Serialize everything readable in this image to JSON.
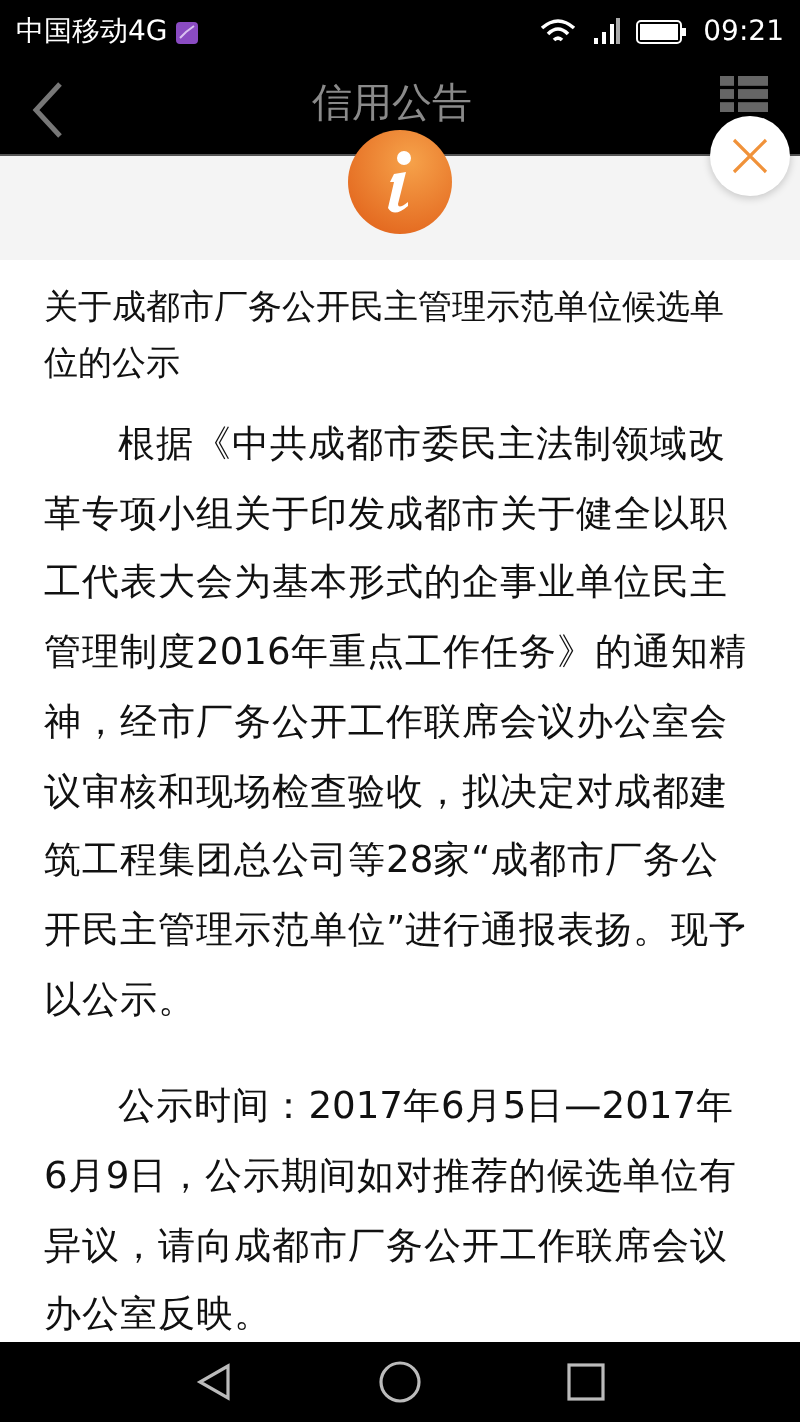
{
  "status_bar": {
    "carrier": "中国移动4G",
    "time": "09:21"
  },
  "header": {
    "title": "信用公告"
  },
  "article": {
    "title": "关于成都市厂务公开民主管理示范单位候选单位的公示",
    "paragraphs": [
      "根据《中共成都市委民主法制领域改革专项小组关于印发成都市关于健全以职工代表大会为基本形式的企事业单位民主管理制度2016年重点工作任务》的通知精神，经市厂务公开工作联席会议办公室会议审核和现场检查验收，拟决定对成都建筑工程集团总公司等28家“成都市厂务公开民主管理示范单位”进行通报表扬。现予以公示。",
      "公示时间：2017年6月5日—2017年6月9日，公示期间如对推荐的候选单位有异议，请向成都市厂务公开工作联席会议办公室反映。"
    ]
  }
}
